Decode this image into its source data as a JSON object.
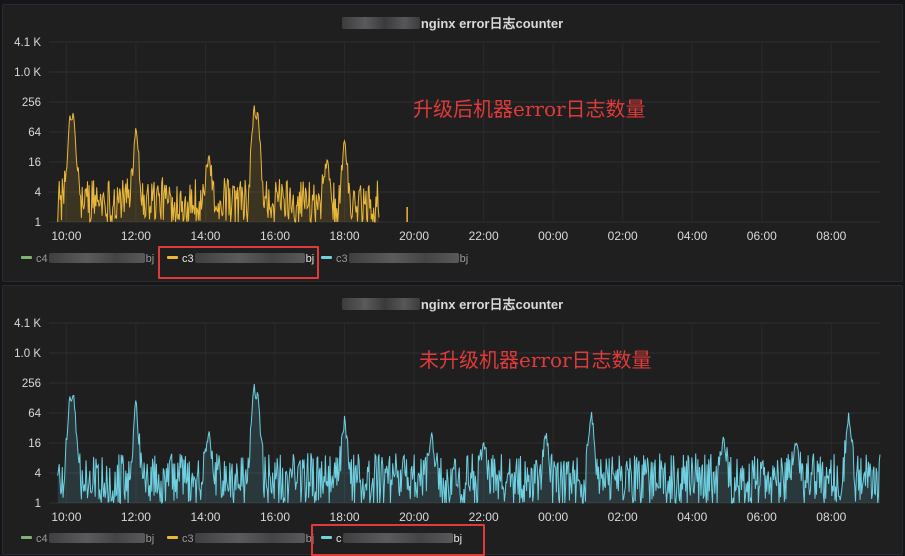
{
  "panels": [
    {
      "title": "nginx error日志counter",
      "annotation": "升级后机器error日志数量",
      "legend": [
        {
          "prefix": "c4",
          "suffix": "bj",
          "color": "#7eb26d"
        },
        {
          "prefix": "c3",
          "suffix": "bj",
          "color": "#eab839"
        },
        {
          "prefix": "c3",
          "suffix": "bj",
          "color": "#6ed0e0"
        }
      ],
      "highlighted_legend_index": 1
    },
    {
      "title": "nginx error日志counter",
      "annotation": "未升级机器error日志数量",
      "legend": [
        {
          "prefix": "c4",
          "suffix": "bj",
          "color": "#7eb26d"
        },
        {
          "prefix": "c3",
          "suffix": "bj",
          "color": "#eab839"
        },
        {
          "prefix": "c",
          "suffix": "bj",
          "color": "#6ed0e0"
        }
      ],
      "highlighted_legend_index": 2
    }
  ],
  "chart_data": [
    {
      "type": "area",
      "title": "nginx error日志counter",
      "yscale": "log2",
      "yticks": [
        "1",
        "4",
        "16",
        "64",
        "256",
        "1.0 K",
        "4.1 K"
      ],
      "ytick_values": [
        1,
        4,
        16,
        64,
        256,
        1024,
        4096
      ],
      "xticks": [
        "10:00",
        "12:00",
        "14:00",
        "16:00",
        "18:00",
        "20:00",
        "22:00",
        "00:00",
        "02:00",
        "04:00",
        "06:00",
        "08:00"
      ],
      "xrange_hours": [
        9.5,
        33.4
      ],
      "series": [
        {
          "color": "#eab839",
          "data_end_hour": 19.0,
          "peaks": [
            [
              10.1,
              140
            ],
            [
              10.2,
              180
            ],
            [
              12.0,
              100
            ],
            [
              14.1,
              25
            ],
            [
              15.4,
              256
            ],
            [
              15.5,
              180
            ],
            [
              17.5,
              20
            ],
            [
              18.0,
              50
            ]
          ],
          "baseline_range": [
            1,
            8
          ],
          "isolated_points": [
            [
              19.8,
              2
            ]
          ]
        }
      ],
      "grid": true
    },
    {
      "type": "area",
      "title": "nginx error日志counter",
      "yscale": "log2",
      "yticks": [
        "1",
        "4",
        "16",
        "64",
        "256",
        "1.0 K",
        "4.1 K"
      ],
      "ytick_values": [
        1,
        4,
        16,
        64,
        256,
        1024,
        4096
      ],
      "xticks": [
        "10:00",
        "12:00",
        "14:00",
        "16:00",
        "18:00",
        "20:00",
        "22:00",
        "00:00",
        "02:00",
        "04:00",
        "06:00",
        "08:00"
      ],
      "xrange_hours": [
        9.5,
        33.4
      ],
      "series": [
        {
          "color": "#6ed0e0",
          "data_end_hour": 33.4,
          "peaks": [
            [
              10.1,
              140
            ],
            [
              10.2,
              180
            ],
            [
              12.0,
              150
            ],
            [
              14.1,
              30
            ],
            [
              15.4,
              300
            ],
            [
              15.5,
              180
            ],
            [
              18.0,
              60
            ],
            [
              20.5,
              30
            ],
            [
              22.0,
              20
            ],
            [
              23.8,
              30
            ],
            [
              25.1,
              80
            ],
            [
              28.9,
              25
            ],
            [
              31.0,
              20
            ],
            [
              32.5,
              70
            ]
          ],
          "baseline_range": [
            1,
            10
          ],
          "isolated_points": []
        }
      ],
      "grid": true
    }
  ]
}
